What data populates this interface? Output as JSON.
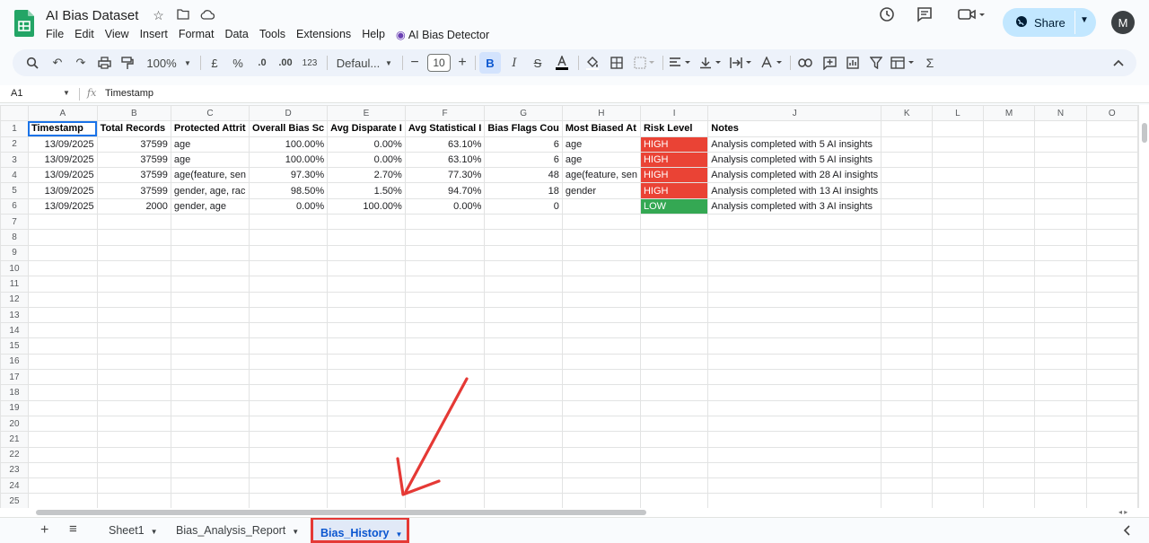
{
  "app": {
    "doc_title": "AI Bias Dataset",
    "menus": [
      "File",
      "Edit",
      "View",
      "Insert",
      "Format",
      "Data",
      "Tools",
      "Extensions",
      "Help"
    ],
    "extension_menu": "AI Bias Detector",
    "share_label": "Share",
    "avatar_letter": "M"
  },
  "toolbar": {
    "zoom": "100%",
    "currency": "£",
    "percent": "%",
    "dec_decrease": ".0",
    "dec_increase": ".00",
    "number_format": "123",
    "font": "Defaul...",
    "font_size": "10",
    "bold": "B",
    "italic": "I"
  },
  "formula_bar": {
    "cell_ref": "A1",
    "fx": "fx",
    "content": "Timestamp"
  },
  "grid": {
    "columns": [
      "A",
      "B",
      "C",
      "D",
      "E",
      "F",
      "G",
      "H",
      "I",
      "J",
      "K",
      "L",
      "M",
      "N",
      "O"
    ],
    "header_row": [
      "Timestamp",
      "Total Records",
      "Protected Attrit",
      "Overall Bias Sc",
      "Avg Disparate I",
      "Avg Statistical I",
      "Bias Flags Cou",
      "Most Biased At",
      "Risk Level",
      "Notes"
    ],
    "rows": [
      [
        "13/09/2025",
        "37599",
        "age",
        "100.00%",
        "0.00%",
        "63.10%",
        "6",
        "age",
        "HIGH",
        "Analysis completed with 5 AI insights"
      ],
      [
        "13/09/2025",
        "37599",
        "age",
        "100.00%",
        "0.00%",
        "63.10%",
        "6",
        "age",
        "HIGH",
        "Analysis completed with 5 AI insights"
      ],
      [
        "13/09/2025",
        "37599",
        "age(feature, sen",
        "97.30%",
        "2.70%",
        "77.30%",
        "48",
        "age(feature, sen",
        "HIGH",
        "Analysis completed with 28 AI insights"
      ],
      [
        "13/09/2025",
        "37599",
        "gender, age, rac",
        "98.50%",
        "1.50%",
        "94.70%",
        "18",
        "gender",
        "HIGH",
        "Analysis completed with 13 AI insights"
      ],
      [
        "13/09/2025",
        "2000",
        "gender, age",
        "0.00%",
        "100.00%",
        "0.00%",
        "0",
        "",
        "LOW",
        "Analysis completed with 3 AI insights"
      ]
    ],
    "row_count": 25
  },
  "tabs": {
    "items": [
      "Sheet1",
      "Bias_Analysis_Report",
      "Bias_History"
    ],
    "active": "Bias_History"
  },
  "colors": {
    "risk_high": "#ea4335",
    "risk_low": "#34a853",
    "annotation": "#e53935",
    "accent": "#0b57d0"
  }
}
